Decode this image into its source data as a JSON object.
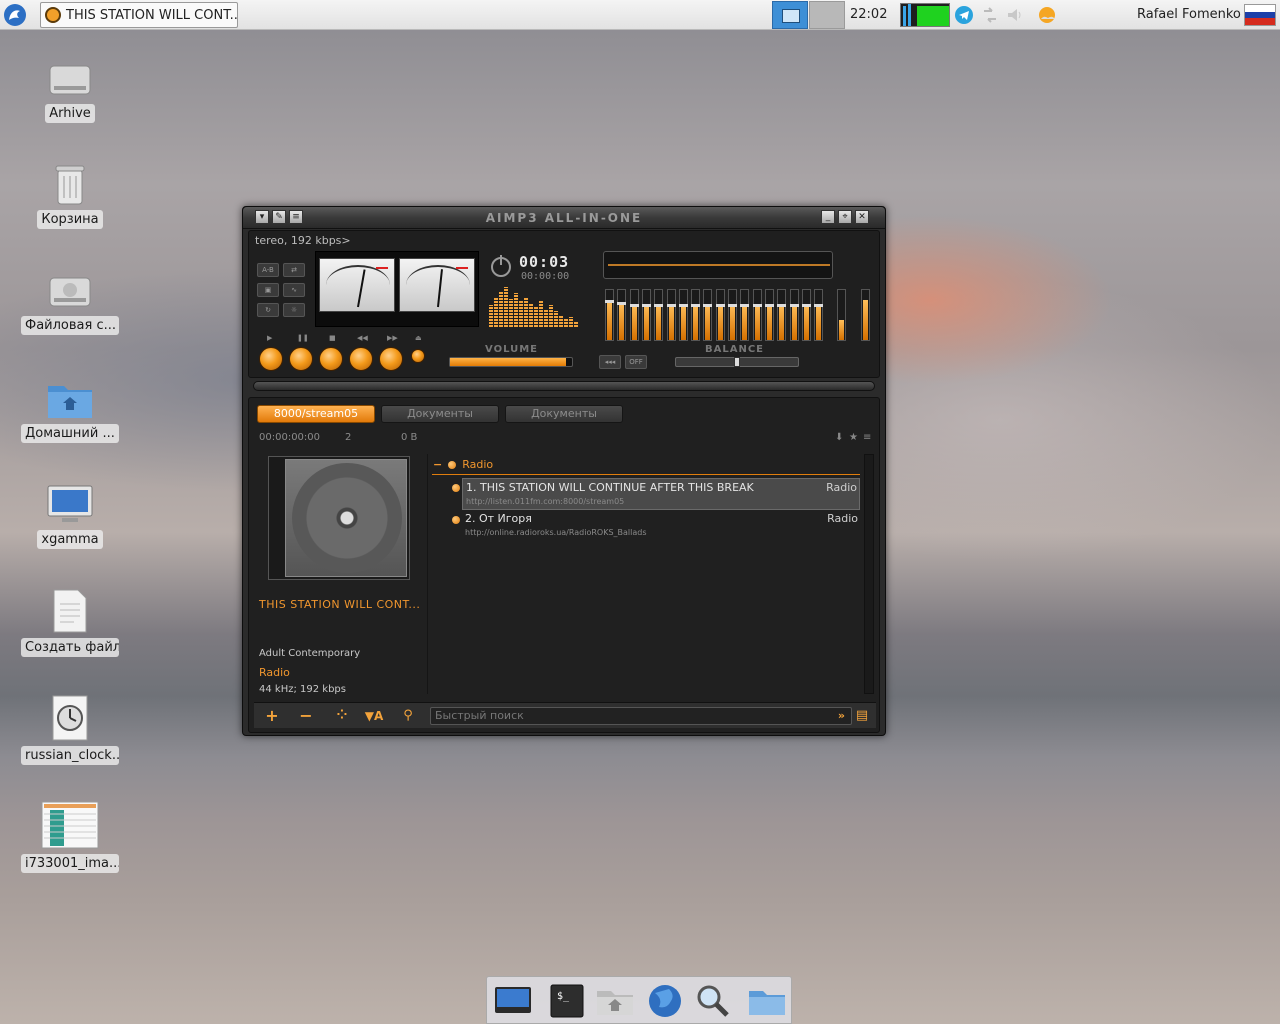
{
  "panel": {
    "task_title": "THIS STATION WILL CONT...",
    "clock": "22:02",
    "user": "Rafael Fomenko"
  },
  "desktop": {
    "icons": [
      {
        "label": "Arhive",
        "icon": "drive-icon"
      },
      {
        "label": "Корзина",
        "icon": "trash-icon"
      },
      {
        "label": "Файловая с...",
        "icon": "filesystem-drive-icon"
      },
      {
        "label": "Домашний ...",
        "icon": "home-folder-icon"
      },
      {
        "label": "xgamma",
        "icon": "monitor-icon"
      },
      {
        "label": "Создать файл",
        "icon": "new-document-icon"
      },
      {
        "label": "russian_clock...",
        "icon": "clock-image-icon"
      },
      {
        "label": "i733001_ima...",
        "icon": "spreadsheet-image-icon"
      }
    ]
  },
  "aimp": {
    "title": "AIMP3  ALL-IN-ONE",
    "info_line": "tereo, 192 kbps>",
    "time": "00:03",
    "time_total": "00:00:00",
    "volume_label": "VOLUME",
    "balance_label": "BALANCE",
    "volume_level": 0.95,
    "balance_level": 0.5,
    "eq_off_label": "OFF",
    "tabs": [
      "8000/stream05",
      "Документы",
      "Документы"
    ],
    "stats": {
      "duration": "00:00:00:00",
      "count": "2",
      "size": "0 B"
    },
    "side": {
      "title": "THIS STATION WILL CONT...",
      "genre": "Adult Contemporary",
      "type": "Radio",
      "format": "44 kHz; 192 kbps"
    },
    "group": "Radio",
    "tracks": [
      {
        "title": "1. THIS STATION WILL CONTINUE AFTER THIS BREAK",
        "url": "http://listen.011fm.com:8000/stream05",
        "genre": "Radio"
      },
      {
        "title": "2. От Игоря",
        "url": "http://online.radioroks.ua/RadioROKS_Ballads",
        "genre": "Radio"
      }
    ],
    "search_placeholder": "Быстрый поиск"
  },
  "colors": {
    "accent": "#f0962e",
    "panel_bg": "#e8e8e8",
    "window_bg": "#2b2b2b"
  }
}
